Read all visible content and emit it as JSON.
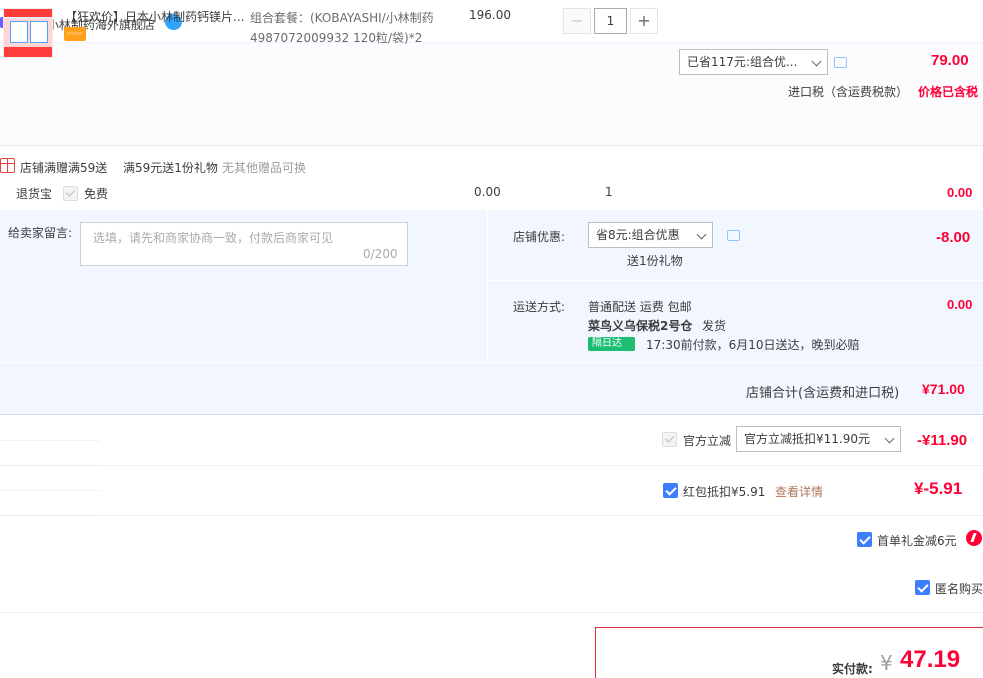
{
  "shop": {
    "label": "店铺: 小林制药海外旗舰店"
  },
  "item": {
    "title": "【狂欢价】日本小林制药钙镁片...",
    "sku": "组合套餐：(KOBAYASHI/小林制药 4987072009932 120粒/袋)*2",
    "unit_price": "196.00",
    "qty": "1",
    "discount_select": "已省117元:组合优...",
    "total": "79.00",
    "tax_label": "进口税（含运费税款）",
    "tax_value": "价格已含税"
  },
  "gift": {
    "label": "店铺满赠满59送",
    "rule": "满59元送1份礼物",
    "note": "无其他赠品可换"
  },
  "returns": {
    "label": "退货宝",
    "free_label": "免费",
    "price": "0.00",
    "qty": "1",
    "total": "0.00"
  },
  "memo": {
    "label": "给卖家留言:",
    "placeholder": "选填，请先和商家协商一致，付款后商家可见",
    "count": "0/200"
  },
  "shop_discount": {
    "label": "店铺优惠:",
    "select": "省8元:组合优惠",
    "gift_note": "送1份礼物",
    "value": "-8.00"
  },
  "shipping": {
    "label": "运送方式:",
    "method": "普通配送 运费 包邮",
    "warehouse": "菜鸟义乌保税2号仓",
    "ship_note": "发货",
    "badge": "隔日达",
    "eta": "17:30前付款，6月10日送达，晚到必赔",
    "value": "0.00"
  },
  "shop_total": {
    "label": "店铺合计(含运费和进口税)",
    "value": "¥71.00"
  },
  "official_discount": {
    "label": "官方立减",
    "select": "官方立减抵扣¥11.90元",
    "value": "-¥11.90"
  },
  "redpacket": {
    "label": "红包抵扣¥5.91",
    "link": "查看详情",
    "value": "¥-5.91"
  },
  "first_order": {
    "label": "首单礼金减6元"
  },
  "anonymous": {
    "label": "匿名购买"
  },
  "pay": {
    "label": "实付款:",
    "currency": "¥",
    "value": "47.19"
  }
}
